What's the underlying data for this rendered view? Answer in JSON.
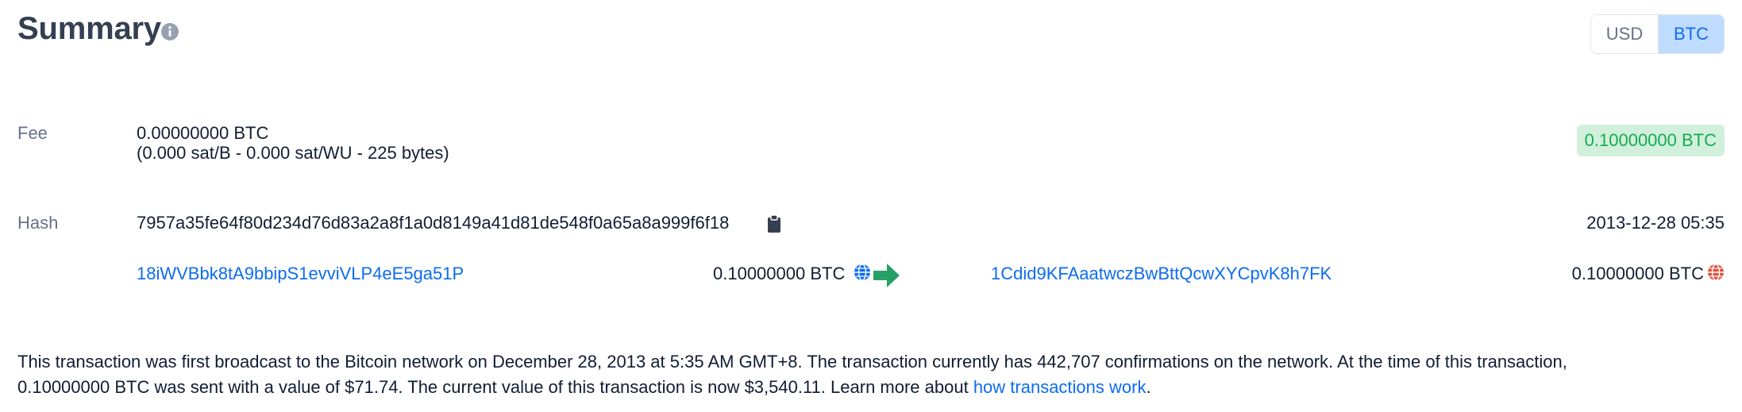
{
  "header": {
    "title": "Summary",
    "currency_options": [
      "USD",
      "BTC"
    ],
    "selected_currency": "BTC"
  },
  "fee": {
    "label": "Fee",
    "amount": "0.00000000 BTC",
    "details": "(0.000 sat/B - 0.000 sat/WU - 225 bytes)"
  },
  "total_badge": "0.10000000 BTC",
  "hash": {
    "label": "Hash",
    "value": "7957a35fe64f80d234d76d83a2a8f1a0d8149a41d81de548f0a65a8a999f6f18",
    "timestamp": "2013-12-28 05:35"
  },
  "io": {
    "input_address": "18iWVBbk8tA9bbipS1evviVLP4eE5ga51P",
    "input_amount": "0.10000000 BTC",
    "output_address": "1Cdid9KFAaatwczBwBttQcwXYCpvK8h7FK",
    "output_amount": "0.10000000 BTC"
  },
  "description": {
    "line1": "This transaction was first broadcast to the Bitcoin network on December 28, 2013 at 5:35 AM GMT+8.  The transaction currently has 442,707 confirmations on the network.  At the time of this transaction,",
    "line2_prefix": "0.10000000 BTC was sent with a value of $71.74. The current value of this transaction is now $3,540.11.  Learn more about ",
    "link_text": "how transactions work",
    "line2_suffix": "."
  },
  "colors": {
    "accent_blue": "#0c6cf2",
    "success_green": "#17ab52",
    "badge_bg": "#d1f0db",
    "arrow_green": "#27a067",
    "output_globe_red": "#e2513a"
  },
  "icons": [
    "info-icon",
    "clipboard-icon",
    "globe-icon",
    "arrow-right-icon",
    "globe-icon"
  ]
}
